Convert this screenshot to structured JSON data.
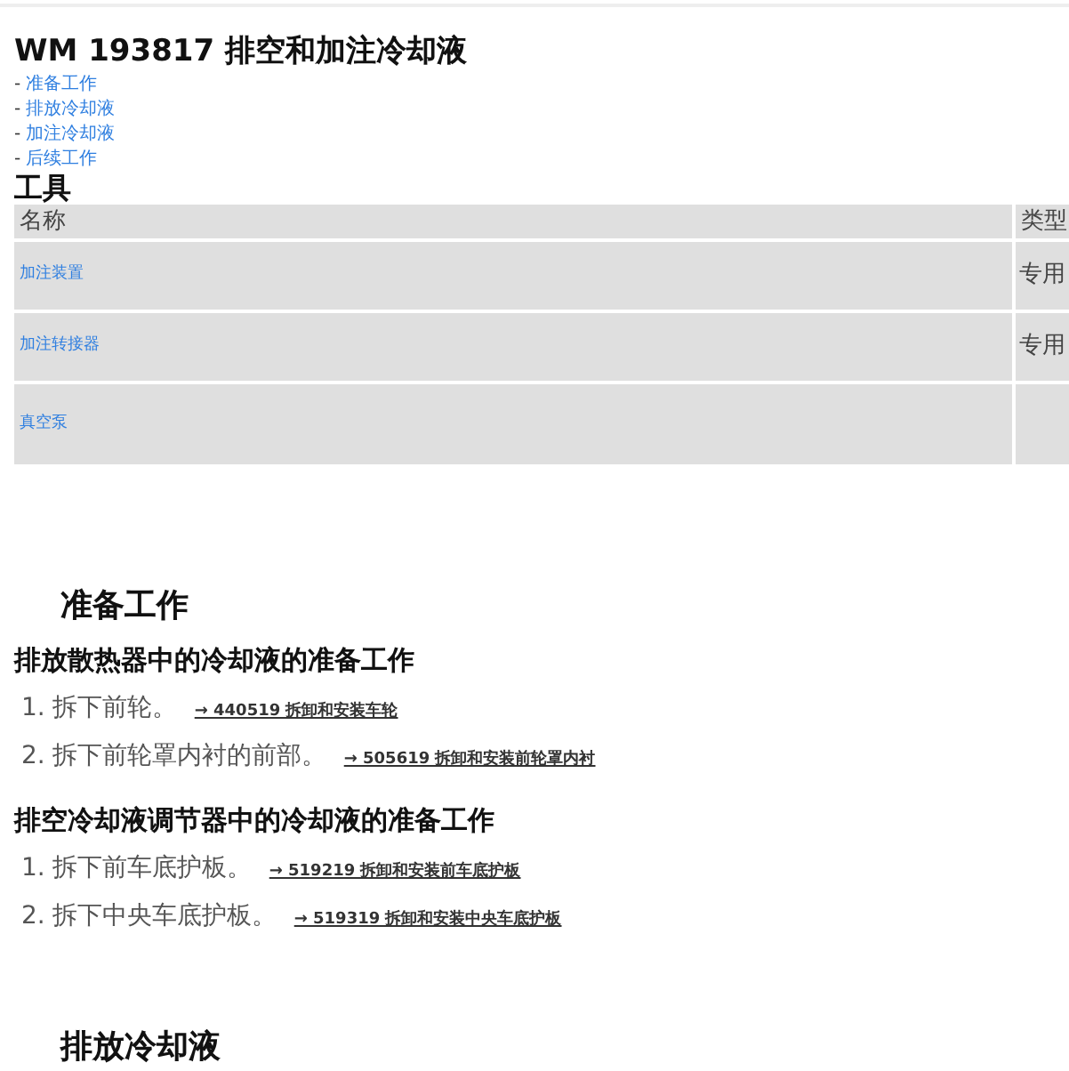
{
  "title": "WM 193817 排空和加注冷却液",
  "toc": [
    {
      "marker": "-",
      "label": "准备工作"
    },
    {
      "marker": "-",
      "label": "排放冷却液"
    },
    {
      "marker": "-",
      "label": "加注冷却液"
    },
    {
      "marker": "-",
      "label": "后续工作"
    }
  ],
  "tools": {
    "heading": "工具",
    "columns": [
      "名称",
      "类型"
    ],
    "rows": [
      {
        "name": "加注装置",
        "type": "专用"
      },
      {
        "name": "加注转接器",
        "type": "专用"
      },
      {
        "name": "真空泵"
      }
    ]
  },
  "sections": [
    {
      "heading": "准备工作",
      "groups": [
        {
          "heading": "排放散热器中的冷却液的准备工作",
          "steps": [
            {
              "number": "1.",
              "text": "拆下前轮。",
              "link": "→ 440519 拆卸和安装车轮"
            },
            {
              "number": "2.",
              "text": "拆下前轮罩内衬的前部。",
              "link": "→ 505619 拆卸和安装前轮罩内衬"
            }
          ]
        },
        {
          "heading": "排空冷却液调节器中的冷却液的准备工作",
          "steps": [
            {
              "number": "1.",
              "text": "拆下前车底护板。",
              "link": "→ 519219 拆卸和安装前车底护板"
            },
            {
              "number": "2.",
              "text": "拆下中央车底护板。",
              "link": "→ 519319 拆卸和安装中央车底护板"
            }
          ]
        }
      ]
    },
    {
      "heading": "排放冷却液"
    }
  ]
}
